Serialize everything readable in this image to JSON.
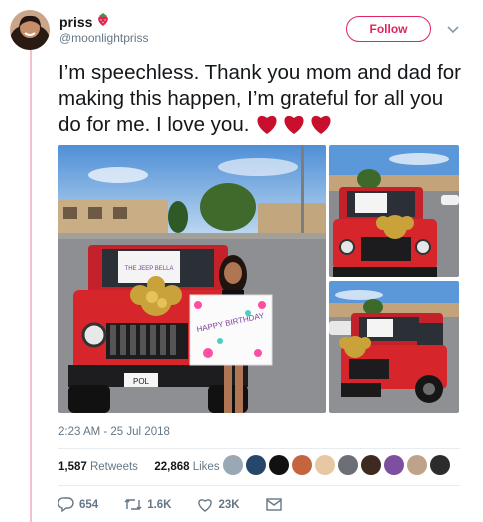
{
  "user": {
    "name": "priss",
    "handle": "@moonlightpriss"
  },
  "follow_label": "Follow",
  "tweet": {
    "text": "I’m speechless. Thank you mom and dad for making this happen, I’m grateful for all you do for me. I love you."
  },
  "photos": {
    "windshield_sign": "THE JEEP BELLA",
    "poster_text": "HAPPY BIRTHDAY",
    "plate_text": "POL"
  },
  "timestamp": "2:23 AM - 25 Jul 2018",
  "stats": {
    "retweets_count": "1,587",
    "retweets_label": "Retweets",
    "likes_count": "22,868",
    "likes_label": "Likes"
  },
  "actions": {
    "replies": "654",
    "retweets": "1.6K",
    "likes": "23K"
  },
  "colors": {
    "accent": "#e0245e",
    "heart": "#c8102e",
    "thread": "#f2c1cc",
    "jeep": "#d7262b"
  },
  "icons": [
    "strawberry-icon",
    "chevron-down-icon",
    "heart-emoji-icon",
    "reply-icon",
    "retweet-icon",
    "like-icon",
    "message-icon"
  ]
}
